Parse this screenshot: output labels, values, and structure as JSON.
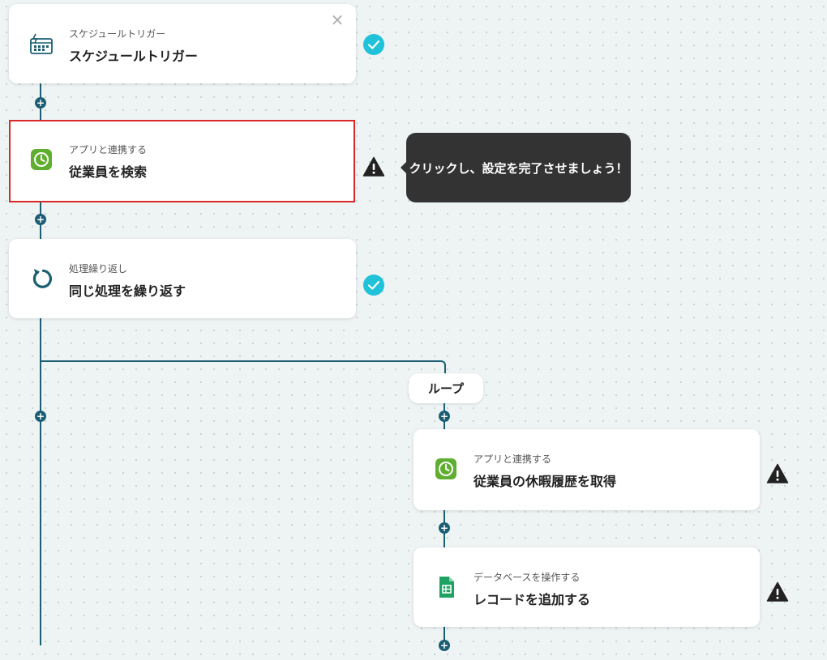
{
  "colors": {
    "connector": "#1b5e74",
    "check": "#1fc2d8",
    "selected_border": "#d92626",
    "tooltip_bg": "#333333"
  },
  "steps": [
    {
      "subtitle": "スケジュールトリガー",
      "title": "スケジュールトリガー",
      "icon": "schedule-calendar-icon",
      "status": "complete"
    },
    {
      "subtitle": "アプリと連携する",
      "title": "従業員を検索",
      "icon": "green-clock-app-icon",
      "status": "warning"
    },
    {
      "subtitle": "処理繰り返し",
      "title": "同じ処理を繰り返す",
      "icon": "loop-arrow-icon",
      "status": "complete"
    },
    {
      "subtitle": "アプリと連携する",
      "title": "従業員の休暇履歴を取得",
      "icon": "green-clock-app-icon",
      "status": "warning"
    },
    {
      "subtitle": "データベースを操作する",
      "title": "レコードを追加する",
      "icon": "google-sheets-icon",
      "status": "warning"
    }
  ],
  "tooltip": {
    "text": "クリックし、設定を完了させましょう！"
  },
  "loop": {
    "label": "ループ"
  },
  "add_step_symbol": "+",
  "close_symbol": "×"
}
